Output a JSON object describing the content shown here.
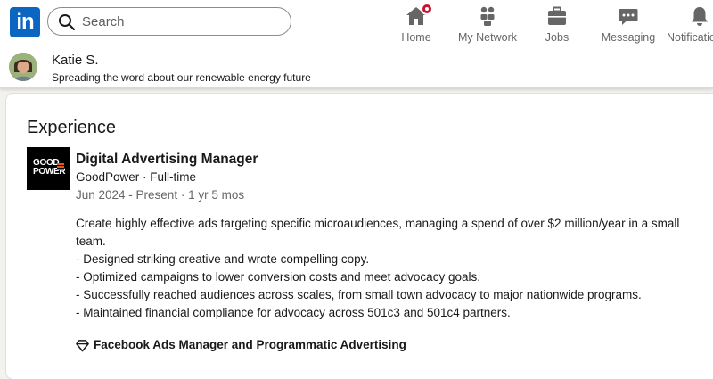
{
  "nav": {
    "logo_text": "in",
    "search_placeholder": "Search",
    "items": [
      {
        "label": "Home",
        "icon": "home-icon"
      },
      {
        "label": "My Network",
        "icon": "people-icon"
      },
      {
        "label": "Jobs",
        "icon": "briefcase-icon"
      },
      {
        "label": "Messaging",
        "icon": "chat-icon"
      },
      {
        "label": "Notifications",
        "icon": "bell-icon"
      }
    ],
    "home_has_notification": true
  },
  "profile": {
    "name": "Katie S.",
    "headline": "Spreading the word about our renewable energy future"
  },
  "experience": {
    "title": "Experience",
    "company_logo_text": [
      "GOOD",
      "POWER"
    ],
    "job_title": "Digital Advertising Manager",
    "company_line": "GoodPower · Full-time",
    "dates": "Jun 2024 - Present · 1 yr 5 mos",
    "description": [
      "Create highly effective ads targeting specific microaudiences, managing a spend of over $2 million/year in a small",
      "team.",
      "- Designed striking creative and wrote compelling copy.",
      "- Optimized campaigns to lower conversion costs and meet advocacy goals.",
      "- Successfully reached audiences across scales, from small town advocacy to major nationwide programs.",
      "- Maintained financial compliance for advocacy across 501c3 and 501c4 partners."
    ],
    "skills": "Facebook Ads Manager and Programmatic Advertising"
  },
  "colors": {
    "brand": "#0a66c2",
    "badge": "#cb112d",
    "logo_accent": "#e8531f",
    "page_bg": "#f4f2ee"
  }
}
